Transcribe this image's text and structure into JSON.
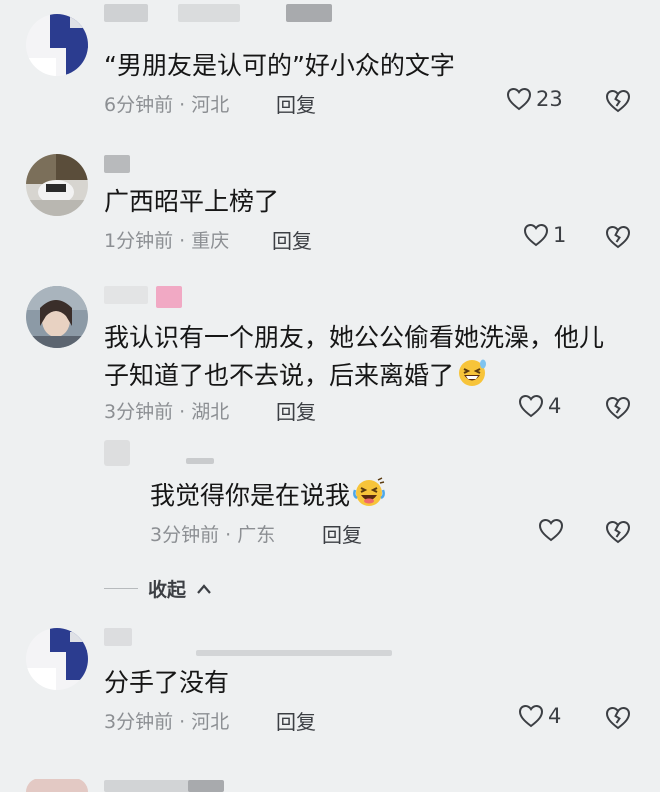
{
  "comments": [
    {
      "text": "“男朋友是认可的”好小众的文字",
      "time": "6分钟前",
      "location": "河北",
      "reply_label": "回复",
      "likes": "23"
    },
    {
      "text": "广西昭平上榜了",
      "time": "1分钟前",
      "location": "重庆",
      "reply_label": "回复",
      "likes": "1"
    },
    {
      "text_line1": "我认识有一个朋友，她公公偷看她洗澡，他儿",
      "text_line2": "子知道了也不去说，后来离婚了",
      "emoji": "grinning-squinting-face-with-sweat",
      "time": "3分钟前",
      "location": "湖北",
      "reply_label": "回复",
      "likes": "4"
    },
    {
      "text": "我觉得你是在说我",
      "emoji": "laughing-tears-face",
      "time": "3分钟前",
      "location": "广东",
      "reply_label": "回复"
    },
    {
      "text": "分手了没有",
      "time": "3分钟前",
      "location": "河北",
      "reply_label": "回复",
      "likes": "4"
    }
  ],
  "collapse_label": "收起",
  "meta_separator": " · ",
  "icons": {
    "like": "heart-outline-icon",
    "dislike": "broken-heart-outline-icon",
    "collapse": "chevron-up-icon"
  },
  "colors": {
    "background": "#eef0f1",
    "text": "#161616",
    "meta": "#8c8f93",
    "action": "#3c3f44"
  }
}
